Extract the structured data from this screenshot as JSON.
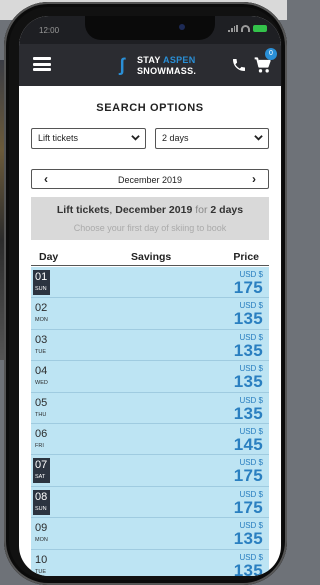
{
  "statusbar": {
    "time": "12:00"
  },
  "navbar": {
    "logo_line1": "STAY",
    "logo_line1_accent": "ASPEN",
    "logo_line2": "SNOWMASS.",
    "cart_count": "0"
  },
  "search": {
    "title": "SEARCH OPTIONS",
    "product_value": "Lift tickets",
    "duration_value": "2 days"
  },
  "month_nav": {
    "label": "December 2019"
  },
  "summary": {
    "product": "Lift tickets",
    "comma": ",",
    "month": "December 2019",
    "for_word": "for",
    "duration": "2 days",
    "instruction": "Choose your first day of skiing to book"
  },
  "table": {
    "headers": {
      "day": "Day",
      "savings": "Savings",
      "price": "Price"
    },
    "rows": [
      {
        "day": "01",
        "weekday": "SUN",
        "currency": "USD $",
        "price": "175",
        "weekend": true
      },
      {
        "day": "02",
        "weekday": "MON",
        "currency": "USD $",
        "price": "135",
        "weekend": false
      },
      {
        "day": "03",
        "weekday": "TUE",
        "currency": "USD $",
        "price": "135",
        "weekend": false
      },
      {
        "day": "04",
        "weekday": "WED",
        "currency": "USD $",
        "price": "135",
        "weekend": false
      },
      {
        "day": "05",
        "weekday": "THU",
        "currency": "USD $",
        "price": "135",
        "weekend": false
      },
      {
        "day": "06",
        "weekday": "FRI",
        "currency": "USD $",
        "price": "145",
        "weekend": false
      },
      {
        "day": "07",
        "weekday": "SAT",
        "currency": "USD $",
        "price": "175",
        "weekend": true
      },
      {
        "day": "08",
        "weekday": "SUN",
        "currency": "USD $",
        "price": "175",
        "weekend": true
      },
      {
        "day": "09",
        "weekday": "MON",
        "currency": "USD $",
        "price": "135",
        "weekend": false
      },
      {
        "day": "10",
        "weekday": "TUE",
        "currency": "USD $",
        "price": "135",
        "weekend": false
      }
    ]
  },
  "colors": {
    "row_bg": "#bde4f3",
    "price_blue": "#2a7fc0",
    "weekend_day_bg": "#2c3440",
    "navbar_bg": "#2b2c31"
  }
}
